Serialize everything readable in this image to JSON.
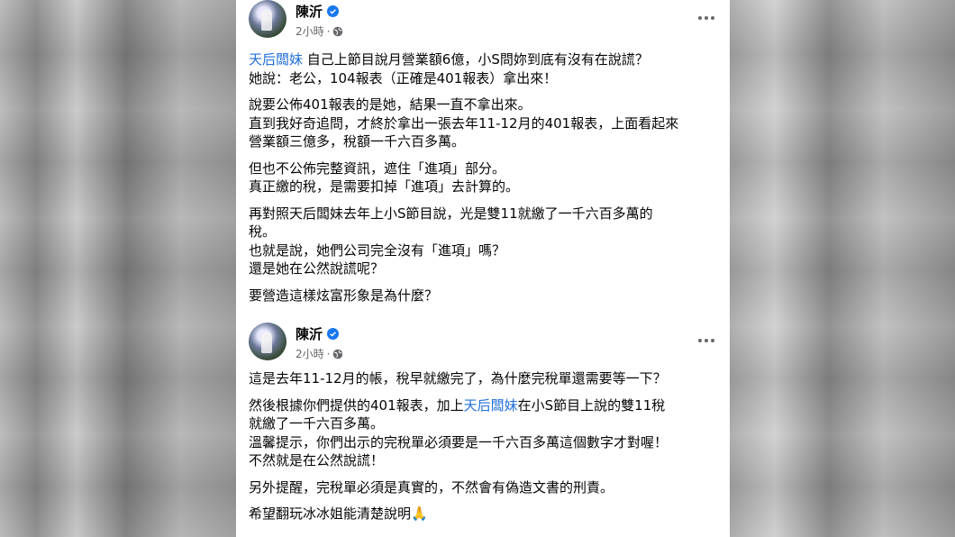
{
  "post1": {
    "author": "陳沂",
    "time": "2小時",
    "dot": "·",
    "paragraphs": [
      {
        "link": "天后闆妹",
        "lines": [
          " 自己上節目說月營業額6億，小S問妳到底有沒有在說謊？",
          "她說：老公，104報表（正確是401報表）拿出來！"
        ]
      },
      {
        "lines": [
          "說要公佈401報表的是她，結果一直不拿出來。",
          "直到我好奇追問，才終於拿出一張去年11-12月的401報表，上面看起來",
          "營業額三億多，稅額一千六百多萬。"
        ]
      },
      {
        "lines": [
          "但也不公佈完整資訊，遮住「進項」部分。",
          "真正繳的稅，是需要扣掉「進項」去計算的。"
        ]
      },
      {
        "lines": [
          "再對照天后闆妹去年上小S節目說，光是雙11就繳了一千六百多萬的",
          "稅。",
          "也就是說，她們公司完全沒有「進項」嗎？",
          "還是她在公然說謊呢？"
        ]
      },
      {
        "lines": [
          "要營造這樣炫富形象是為什麼？"
        ]
      }
    ]
  },
  "post2": {
    "author": "陳沂",
    "time": "2小時",
    "dot": "·",
    "p1": "這是去年11-12月的帳，稅早就繳完了，為什麼完稅單還需要等一下？",
    "p2_before": "然後根據你們提供的401報表，加上",
    "p2_link": "天后闆妹",
    "p2_after": "在小S節目上說的雙11稅",
    "p2_line2": "就繳了一千六百多萬。",
    "p2_line3": "溫馨提示，你們出示的完稅單必須要是一千六百多萬這個數字才對喔！",
    "p2_line4": "不然就是在公然說謊！",
    "p3": "另外提醒，完稅單必須是真實的，不然會有偽造文書的刑責。",
    "p4": "希望翻玩冰冰姐能清楚說明",
    "p4_emoji": "🙏"
  },
  "colors": {
    "link": "#216fdb",
    "verified": "#1877f2",
    "meta": "#65676b"
  },
  "icons": {
    "verified": "verified-badge-icon",
    "audience": "globe-icon",
    "more": "more-options-icon"
  }
}
